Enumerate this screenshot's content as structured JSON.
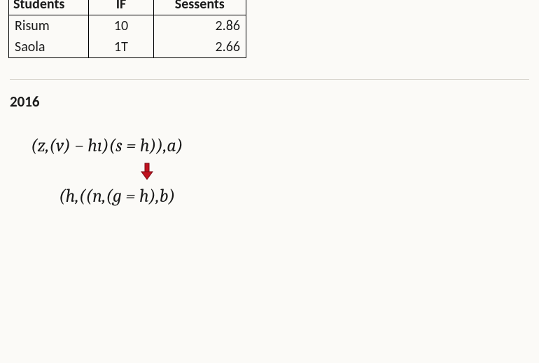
{
  "table": {
    "headers": [
      "Students",
      "IF",
      "Sessents"
    ],
    "rows": [
      {
        "c1": "Risum",
        "c2": "10",
        "c3": "2.86"
      },
      {
        "c1": "Saola",
        "c2": "1T",
        "c3": "2.66"
      }
    ]
  },
  "year_label": "2016",
  "formula": {
    "line1": "(z,(v) − hı)(s = h)),a)",
    "line2": "(h,((n,(g = h),b)"
  },
  "arrow": {
    "color": "#c1121f"
  }
}
